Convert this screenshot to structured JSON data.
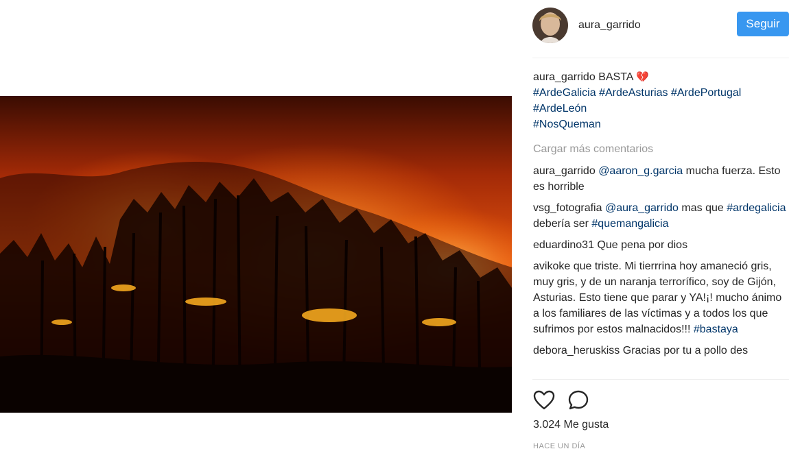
{
  "post": {
    "photo": {
      "subject": "forest-fire-night-icon"
    },
    "header": {
      "username": "aura_garrido",
      "follow_label": "Seguir"
    },
    "caption": {
      "username": "aura_garrido",
      "text": "BASTA",
      "emoji": "💔",
      "hashtags": [
        "#ArdeGalicia",
        "#ArdeAsturias",
        "#ArdePortugal",
        "#ArdeLeón",
        "#NosQueman"
      ]
    },
    "load_more_label": "Cargar más comentarios",
    "comments": [
      {
        "username": "aura_garrido",
        "mention": "@aaron_g.garcia",
        "text": "mucha fuerza. Esto es horrible"
      },
      {
        "username": "vsg_fotografia",
        "mention": "@aura_garrido",
        "text_before": "mas que",
        "tag1": "#ardegalicia",
        "text_middle": "debería ser",
        "tag2": "#quemangalicia"
      },
      {
        "username": "eduardino31",
        "text": "Que pena por dios"
      },
      {
        "username": "avikoke",
        "text": "que triste. Mi tierrrina hoy amaneció gris, muy gris, y de un naranja terrorífico, soy de Gijón, Asturias. Esto tiene que parar y YA!¡! mucho ánimo a los familiares de las víctimas y a todos los que sufrimos por estos malnacidos!!!",
        "tag": "#bastaya"
      },
      {
        "username": "debora_heruskiss",
        "text": "Gracias por tu a pollo des"
      }
    ],
    "likes_text": "3.024 Me gusta",
    "time_ago": "HACE UN DÍA",
    "icons": {
      "like": "heart-outline-icon",
      "comment": "comment-bubble-icon"
    },
    "colors": {
      "follow": "#3897f0",
      "link": "#003569",
      "muted": "#999999",
      "broken_heart": "#c8102e"
    }
  }
}
